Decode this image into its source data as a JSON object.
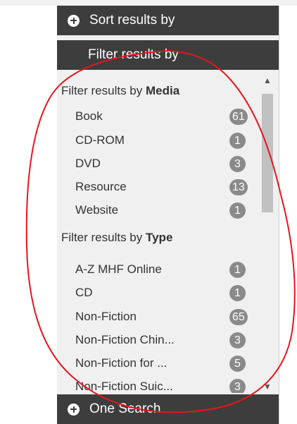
{
  "panel": {
    "sort_label": "Sort results by",
    "filter_label": "Filter results by",
    "search_label": "One Search"
  },
  "groups": [
    {
      "title_prefix": "Filter results by ",
      "title_strong": "Media",
      "items": [
        {
          "label": "Book",
          "count": "61"
        },
        {
          "label": "CD-ROM",
          "count": "1"
        },
        {
          "label": "DVD",
          "count": "3"
        },
        {
          "label": "Resource",
          "count": "13"
        },
        {
          "label": "Website",
          "count": "1"
        }
      ]
    },
    {
      "title_prefix": "Filter results by ",
      "title_strong": "Type",
      "items": [
        {
          "label": "A-Z MHF Online",
          "count": "1"
        },
        {
          "label": "CD",
          "count": "1"
        },
        {
          "label": "Non-Fiction",
          "count": "65"
        },
        {
          "label": "Non-Fiction Chin...",
          "count": "3"
        },
        {
          "label": "Non-Fiction for ...",
          "count": "5"
        },
        {
          "label": "Non-Fiction Suic...",
          "count": "3"
        }
      ]
    }
  ],
  "scrollbar": {
    "up_icon": "chevron-up-icon",
    "down_icon": "chevron-down-icon"
  },
  "colors": {
    "header_bg": "#3d3d3d",
    "badge_bg": "#8a8a8a",
    "annotation": "#e8141c"
  }
}
